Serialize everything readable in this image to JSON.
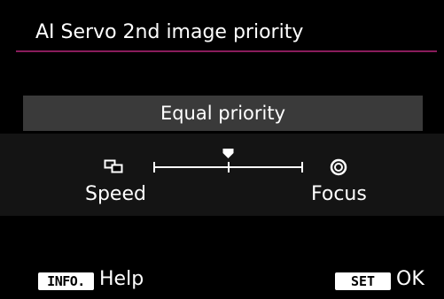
{
  "menu": {
    "title": "AI Servo 2nd image priority",
    "accent_color": "#8a1c5c"
  },
  "setting": {
    "current_value": "Equal priority"
  },
  "slider": {
    "left_label": "Speed",
    "right_label": "Focus",
    "left_icon": "continuous-shooting-speed-icon",
    "right_icon": "focus-priority-icon",
    "position": 0,
    "min": -2,
    "max": 2
  },
  "footer": {
    "info_key": "INFO.",
    "info_label": "Help",
    "set_key": "SET",
    "ok_label": "OK"
  }
}
